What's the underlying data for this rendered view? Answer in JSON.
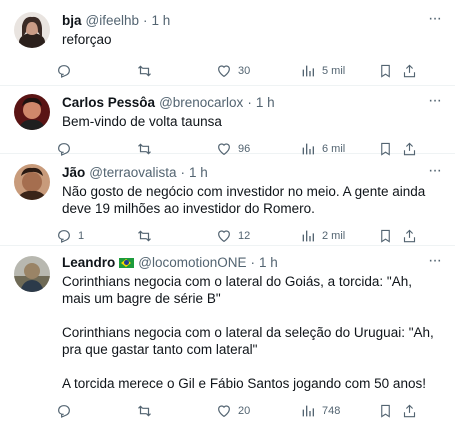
{
  "tweets": [
    {
      "name": "bja",
      "handle": "@ifeelhb",
      "dot": "·",
      "time": "1 h",
      "text": "reforçao",
      "replies": "",
      "retweets": "",
      "likes": "30",
      "views": "5 mil",
      "avatar_color": "#3a2a25"
    },
    {
      "name": "Carlos Pessôa",
      "handle": "@brenocarlox",
      "dot": "·",
      "time": "1 h",
      "text": "Bem-vindo de volta taunsa",
      "replies": "",
      "retweets": "",
      "likes": "96",
      "views": "6 mil",
      "avatar_color": "#7a2020"
    },
    {
      "name": "Jão",
      "handle": "@terraovalista",
      "dot": "·",
      "time": "1 h",
      "text": "Não gosto de negócio com investidor no meio. A gente ainda deve 19 milhões ao investidor do Romero.",
      "replies": "1",
      "retweets": "",
      "likes": "12",
      "views": "2 mil",
      "avatar_color": "#4a2c1e"
    },
    {
      "name": "Leandro",
      "handle": "@locomotionONE",
      "dot": "·",
      "time": "1 h",
      "text": "Corinthians negocia com o lateral do Goiás, a torcida: \"Ah, mais um bagre de série B\"\n\nCorinthians negocia com o lateral da seleção do Uruguai: \"Ah, pra que gastar tanto com lateral\"\n\nA torcida merece o Gil e Fábio Santos jogando com 50 anos!",
      "replies": "",
      "retweets": "",
      "likes": "20",
      "views": "748",
      "avatar_color": "#8a7a5a"
    }
  ],
  "icons": {
    "reply": "reply-icon",
    "retweet": "retweet-icon",
    "like": "heart-icon",
    "views": "views-icon",
    "bookmark": "bookmark-icon",
    "share": "share-icon",
    "more": "more-icon"
  },
  "more_glyph": "···"
}
